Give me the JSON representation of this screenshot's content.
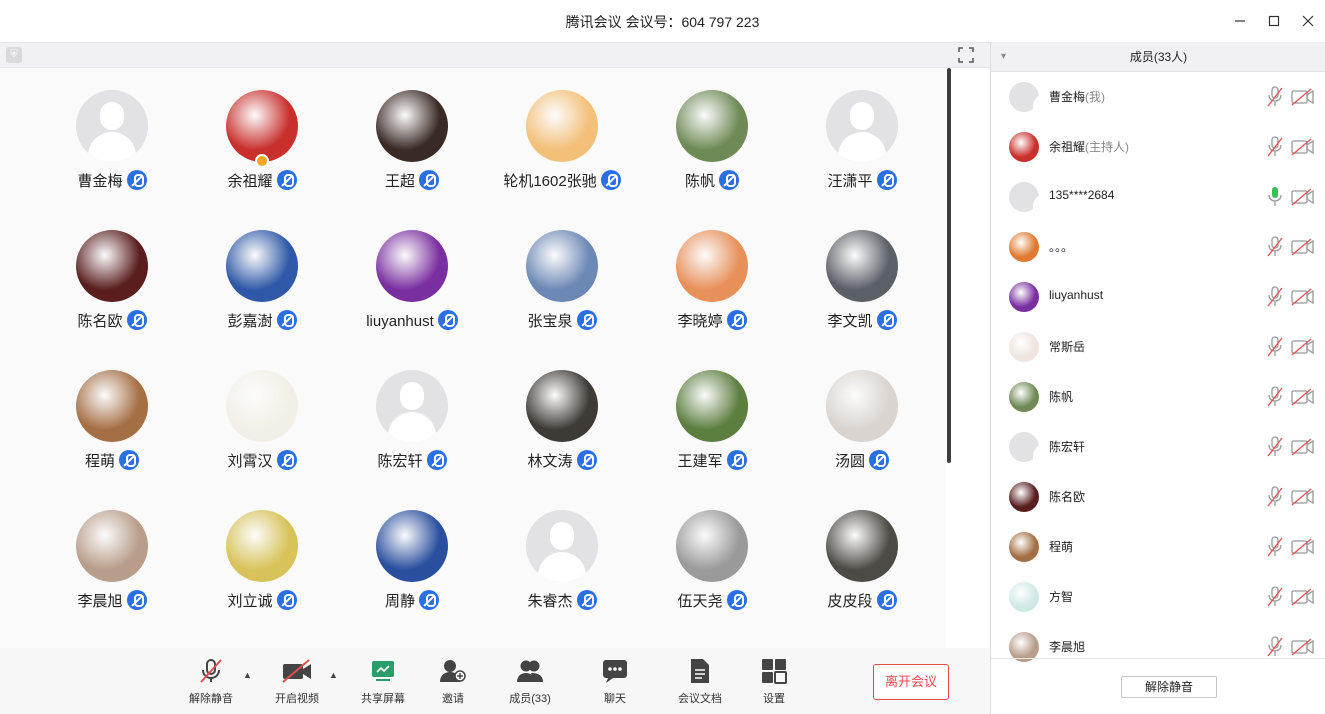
{
  "window": {
    "title": "腾讯会议 会议号：604 797 223"
  },
  "participants": [
    {
      "name": "曹金梅",
      "avatar": "default",
      "host": false
    },
    {
      "name": "余祖耀",
      "avatar": "#c9302c",
      "host": true
    },
    {
      "name": "王超",
      "avatar": "#3a2a26",
      "host": false
    },
    {
      "name": "轮机1602张驰",
      "avatar": "#f3c07a",
      "host": false
    },
    {
      "name": "陈帆",
      "avatar": "#6f8a56",
      "host": false
    },
    {
      "name": "汪潇平",
      "avatar": "default",
      "host": false
    },
    {
      "name": "陈名欧",
      "avatar": "#5a1e1e",
      "host": false
    },
    {
      "name": "彭嘉澍",
      "avatar": "#2f59a8",
      "host": false
    },
    {
      "name": "liuyanhust",
      "avatar": "#7a2fa0",
      "host": false
    },
    {
      "name": "张宝泉",
      "avatar": "#6c88b5",
      "host": false
    },
    {
      "name": "李晓婷",
      "avatar": "#e8905a",
      "host": false
    },
    {
      "name": "李文凯",
      "avatar": "#5b5f66",
      "host": false
    },
    {
      "name": "程萌",
      "avatar": "#a56f45",
      "host": false
    },
    {
      "name": "刘霄汉",
      "avatar": "#f2efe6",
      "host": false
    },
    {
      "name": "陈宏轩",
      "avatar": "default",
      "host": false
    },
    {
      "name": "林文涛",
      "avatar": "#3e3a36",
      "host": false
    },
    {
      "name": "王建军",
      "avatar": "#5c7e3f",
      "host": false
    },
    {
      "name": "汤圆",
      "avatar": "#d9d4cf",
      "host": false
    },
    {
      "name": "李晨旭",
      "avatar": "#b89d8a",
      "host": false
    },
    {
      "name": "刘立诚",
      "avatar": "#d8c35a",
      "host": false
    },
    {
      "name": "周静",
      "avatar": "#2a4f9e",
      "host": false
    },
    {
      "name": "朱睿杰",
      "avatar": "default",
      "host": false
    },
    {
      "name": "伍天尧",
      "avatar": "#9a9a9a",
      "host": false
    },
    {
      "name": "皮皮段",
      "avatar": "#4d4b45",
      "host": false
    }
  ],
  "toolbar": {
    "mute": "解除静音",
    "video": "开启视频",
    "share": "共享屏幕",
    "invite": "邀请",
    "members": "成员(33)",
    "chat": "聊天",
    "docs": "会议文档",
    "settings": "设置",
    "leave": "离开会议"
  },
  "panel": {
    "title": "成员(33人)",
    "members": [
      {
        "name": "曹金梅",
        "role": "(我)",
        "avatar": "default",
        "mic": "muted"
      },
      {
        "name": "余祖耀",
        "role": "(主持人)",
        "avatar": "#c9302c",
        "mic": "muted"
      },
      {
        "name": "135****2684",
        "role": "",
        "avatar": "default",
        "mic": "on"
      },
      {
        "name": "。。。",
        "role": "",
        "avatar": "#e07a30",
        "mic": "muted"
      },
      {
        "name": "liuyanhust",
        "role": "",
        "avatar": "#7a2fa0",
        "mic": "muted"
      },
      {
        "name": "常斯岳",
        "role": "",
        "avatar": "#efe4e0",
        "mic": "muted"
      },
      {
        "name": "陈帆",
        "role": "",
        "avatar": "#6f8a56",
        "mic": "muted"
      },
      {
        "name": "陈宏轩",
        "role": "",
        "avatar": "default",
        "mic": "muted"
      },
      {
        "name": "陈名欧",
        "role": "",
        "avatar": "#5a1e1e",
        "mic": "muted"
      },
      {
        "name": "程萌",
        "role": "",
        "avatar": "#a56f45",
        "mic": "muted"
      },
      {
        "name": "方智",
        "role": "",
        "avatar": "#cfe9e6",
        "mic": "muted"
      },
      {
        "name": "李晨旭",
        "role": "",
        "avatar": "#b89d8a",
        "mic": "muted"
      }
    ],
    "unmute_all": "解除静音"
  },
  "colors": {
    "accent": "#2b6fe6",
    "danger": "#e84b4b",
    "mic_on": "#3bbf56",
    "muted_red": "#e05050"
  }
}
